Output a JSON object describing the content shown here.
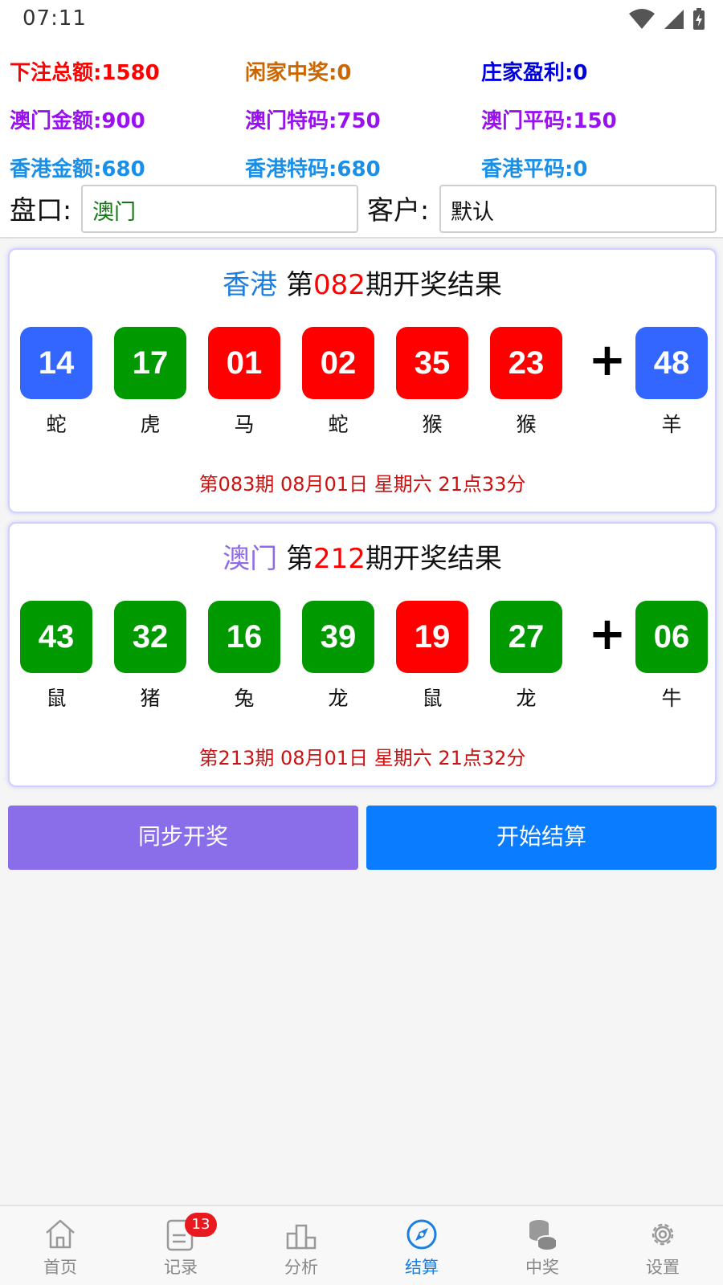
{
  "status_bar": {
    "time": "07:11"
  },
  "summary": {
    "total_bet": "下注总额:1580",
    "player_win": "闲家中奖:0",
    "banker_profit": "庄家盈利:0",
    "macau_amount": "澳门金额:900",
    "macau_special": "澳门特码:750",
    "macau_normal": "澳门平码:150",
    "hk_amount": "香港金额:680",
    "hk_special": "香港特码:680",
    "hk_normal": "香港平码:0"
  },
  "form": {
    "market_label": "盘口:",
    "market_value": "澳门",
    "customer_label": "客户:",
    "customer_value": "默认"
  },
  "results": [
    {
      "region": "香港",
      "title_prefix": "第",
      "issue": "082",
      "title_suffix": "期开奖结果",
      "balls": [
        {
          "number": "14",
          "zodiac": "蛇",
          "color": "blue"
        },
        {
          "number": "17",
          "zodiac": "虎",
          "color": "green"
        },
        {
          "number": "01",
          "zodiac": "马",
          "color": "red"
        },
        {
          "number": "02",
          "zodiac": "蛇",
          "color": "red"
        },
        {
          "number": "35",
          "zodiac": "猴",
          "color": "red"
        },
        {
          "number": "23",
          "zodiac": "猴",
          "color": "red"
        }
      ],
      "special": {
        "number": "48",
        "zodiac": "羊",
        "color": "blue"
      },
      "next_draw": "第083期 08月01日 星期六  21点33分"
    },
    {
      "region": "澳门",
      "title_prefix": "第",
      "issue": "212",
      "title_suffix": "期开奖结果",
      "balls": [
        {
          "number": "43",
          "zodiac": "鼠",
          "color": "green"
        },
        {
          "number": "32",
          "zodiac": "猪",
          "color": "green"
        },
        {
          "number": "16",
          "zodiac": "兔",
          "color": "green"
        },
        {
          "number": "39",
          "zodiac": "龙",
          "color": "green"
        },
        {
          "number": "19",
          "zodiac": "鼠",
          "color": "red"
        },
        {
          "number": "27",
          "zodiac": "龙",
          "color": "green"
        }
      ],
      "special": {
        "number": "06",
        "zodiac": "牛",
        "color": "green"
      },
      "next_draw": "第213期 08月01日 星期六  21点32分"
    }
  ],
  "plus_sign": "+",
  "buttons": {
    "sync": "同步开奖",
    "settle": "开始结算"
  },
  "tabs": [
    {
      "label": "首页",
      "icon": "home-icon"
    },
    {
      "label": "记录",
      "icon": "record-icon",
      "badge": "13"
    },
    {
      "label": "分析",
      "icon": "podium-icon"
    },
    {
      "label": "结算",
      "icon": "compass-icon",
      "active": true
    },
    {
      "label": "中奖",
      "icon": "coins-icon"
    },
    {
      "label": "设置",
      "icon": "gear-icon"
    }
  ],
  "colors": {
    "ball_red": "#ff0000",
    "ball_green": "#009900",
    "ball_blue": "#3366ff",
    "hk_region": "#1a7fe0",
    "macau_region": "#8f6be8",
    "issue": "#ff0000",
    "tab_active": "#1a7fe0",
    "sync_button": "#8a6de9",
    "settle_button": "#0a7cff"
  }
}
